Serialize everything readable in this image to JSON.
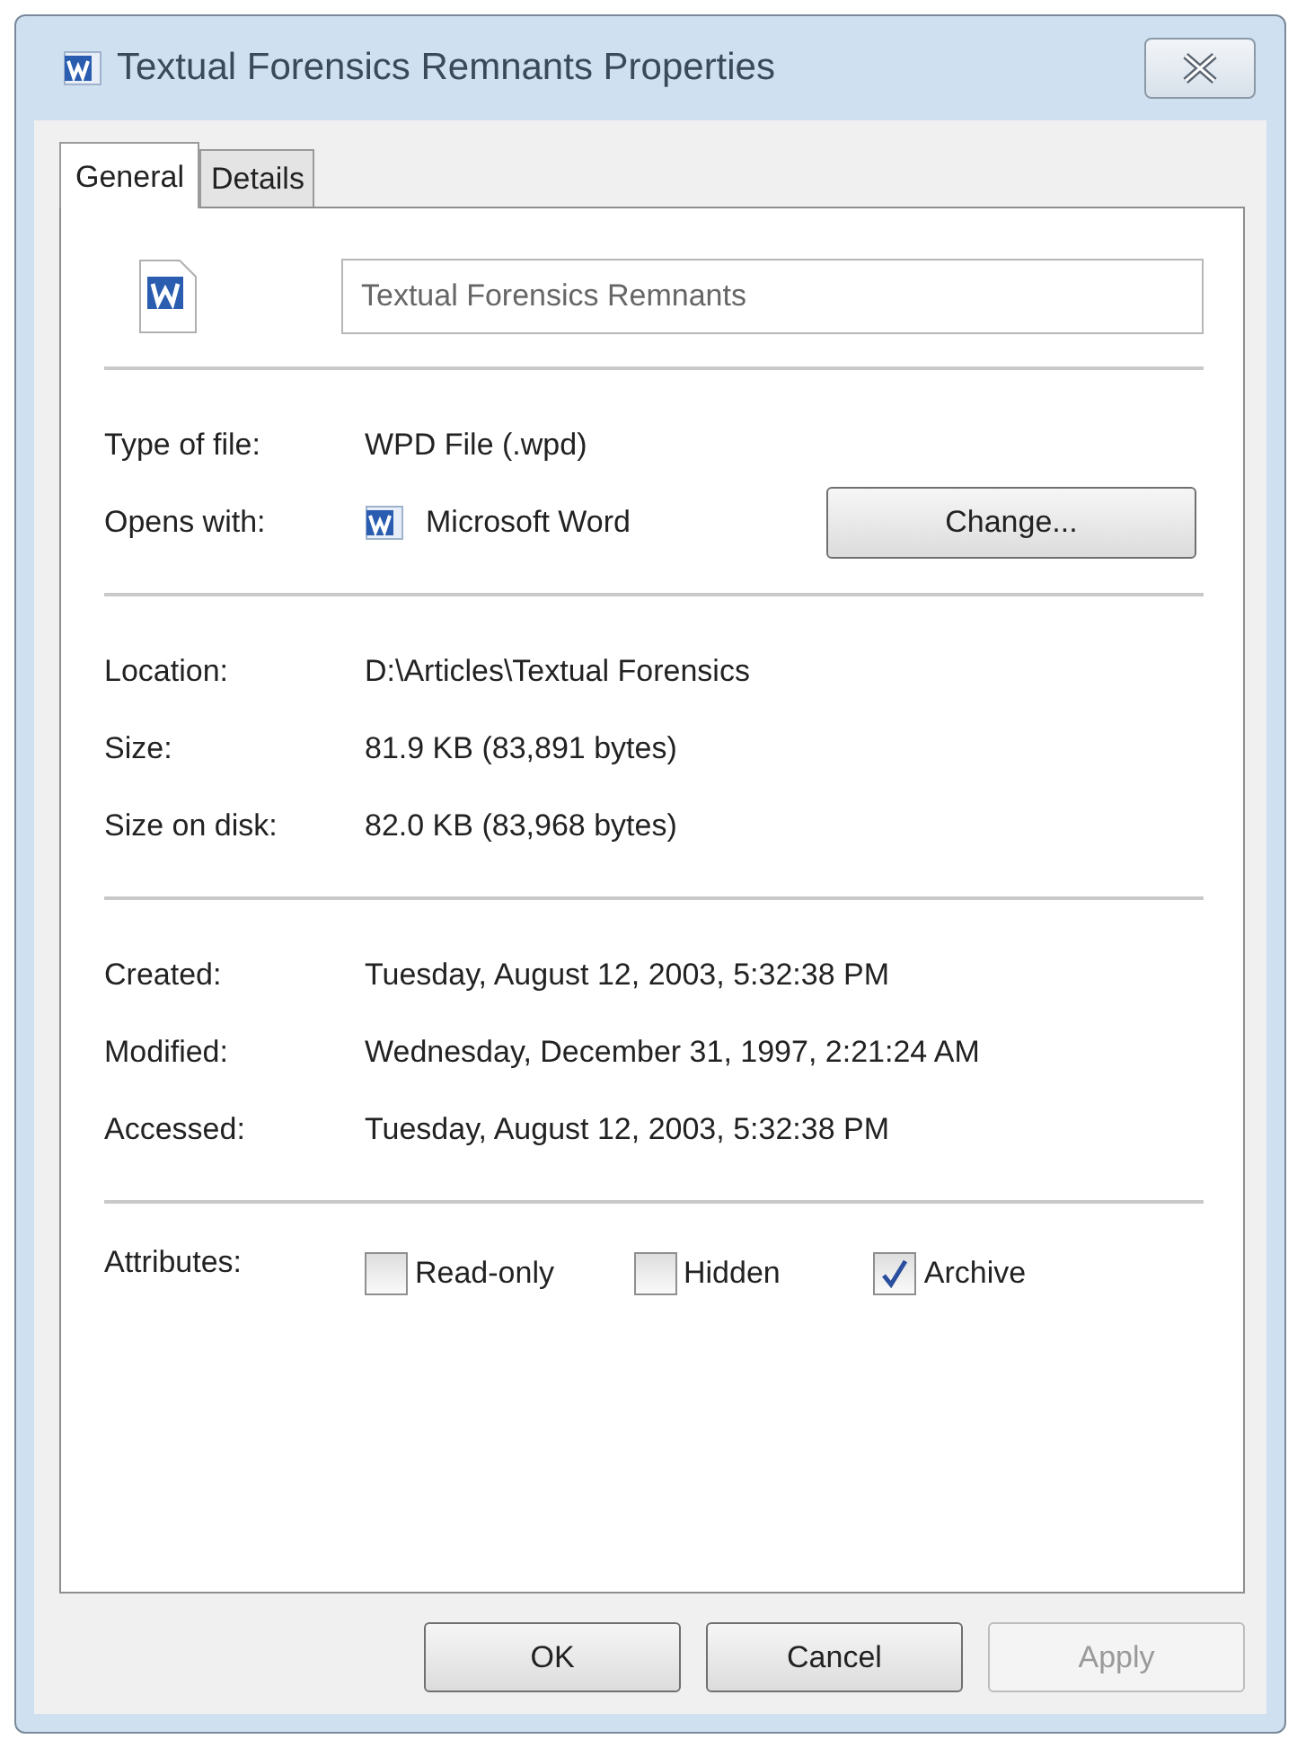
{
  "window": {
    "title": "Textual Forensics Remnants Properties"
  },
  "tabs": [
    {
      "label": "General",
      "selected": true
    },
    {
      "label": "Details",
      "selected": false
    }
  ],
  "name_field": {
    "value": "Textual Forensics Remnants"
  },
  "sections": [
    [
      {
        "label": "Type of file:",
        "value": "WPD File (.wpd)",
        "kind": "text"
      },
      {
        "label": "Opens with:",
        "value": "Microsoft Word",
        "kind": "app",
        "button": "Change..."
      }
    ],
    [
      {
        "label": "Location:",
        "value": "D:\\Articles\\Textual Forensics",
        "kind": "text"
      },
      {
        "label": "Size:",
        "value": "81.9 KB (83,891 bytes)",
        "kind": "text"
      },
      {
        "label": "Size on disk:",
        "value": "82.0 KB (83,968 bytes)",
        "kind": "text"
      }
    ],
    [
      {
        "label": "Created:",
        "value": "Tuesday, August 12, 2003, 5:32:38 PM",
        "kind": "text"
      },
      {
        "label": "Modified:",
        "value": "Wednesday, December 31, 1997, 2:21:24 AM",
        "kind": "text"
      },
      {
        "label": "Accessed:",
        "value": "Tuesday, August 12, 2003, 5:32:38 PM",
        "kind": "text"
      }
    ]
  ],
  "attributes": {
    "label": "Attributes:",
    "options": [
      {
        "label": "Read-only",
        "checked": false
      },
      {
        "label": "Hidden",
        "checked": false
      },
      {
        "label": "Archive",
        "checked": true
      }
    ]
  },
  "buttons": [
    {
      "label": "OK",
      "disabled": false
    },
    {
      "label": "Cancel",
      "disabled": false
    },
    {
      "label": "Apply",
      "disabled": true
    }
  ]
}
